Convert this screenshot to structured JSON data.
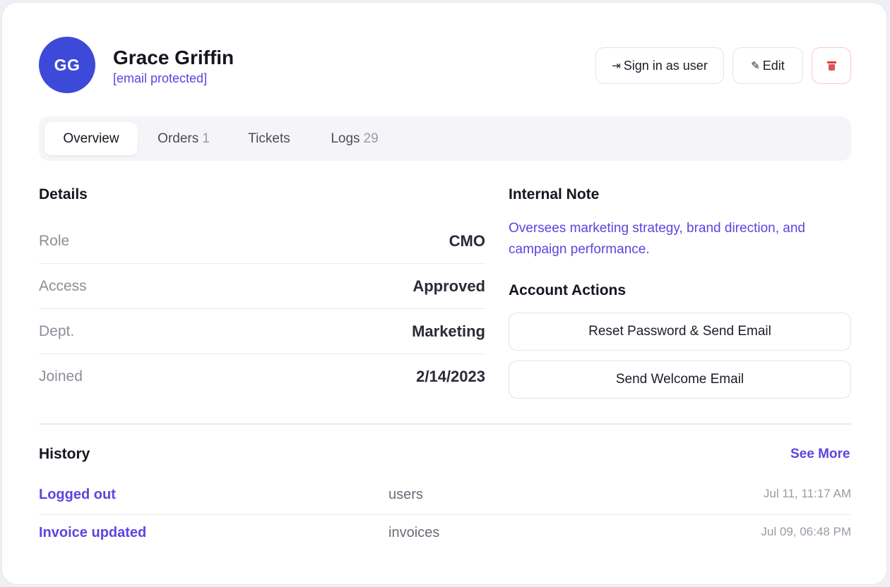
{
  "profile": {
    "initials": "GG",
    "name": "Grace Griffin",
    "email": "[email protected]"
  },
  "header_actions": {
    "signin_icon": "⇥",
    "signin_label": "Sign in as user",
    "edit_icon": "✎",
    "edit_label": "Edit",
    "delete_icon": "trash-icon"
  },
  "tabs": [
    {
      "label": "Overview",
      "count": "",
      "active": true
    },
    {
      "label": "Orders",
      "count": "1",
      "active": false
    },
    {
      "label": "Tickets",
      "count": "",
      "active": false
    },
    {
      "label": "Logs",
      "count": "29",
      "active": false
    }
  ],
  "details": {
    "title": "Details",
    "rows": [
      {
        "label": "Role",
        "value": "CMO"
      },
      {
        "label": "Access",
        "value": "Approved"
      },
      {
        "label": "Dept.",
        "value": "Marketing"
      },
      {
        "label": "Joined",
        "value": "2/14/2023"
      }
    ]
  },
  "internal_note": {
    "title": "Internal Note",
    "text": "Oversees marketing strategy, brand direction, and campaign performance."
  },
  "account_actions": {
    "title": "Account Actions",
    "reset_label": "Reset Password & Send Email",
    "welcome_label": "Send Welcome Email"
  },
  "history": {
    "title": "History",
    "see_more": "See More",
    "items": [
      {
        "event": "Logged out",
        "module": "users",
        "time": "Jul 11, 11:17 AM"
      },
      {
        "event": "Invoice updated",
        "module": "invoices",
        "time": "Jul 09, 06:48 PM"
      }
    ]
  },
  "colors": {
    "accent": "#5b45e0",
    "avatar_bg": "#3d4ad9",
    "danger": "#d93b3b"
  }
}
